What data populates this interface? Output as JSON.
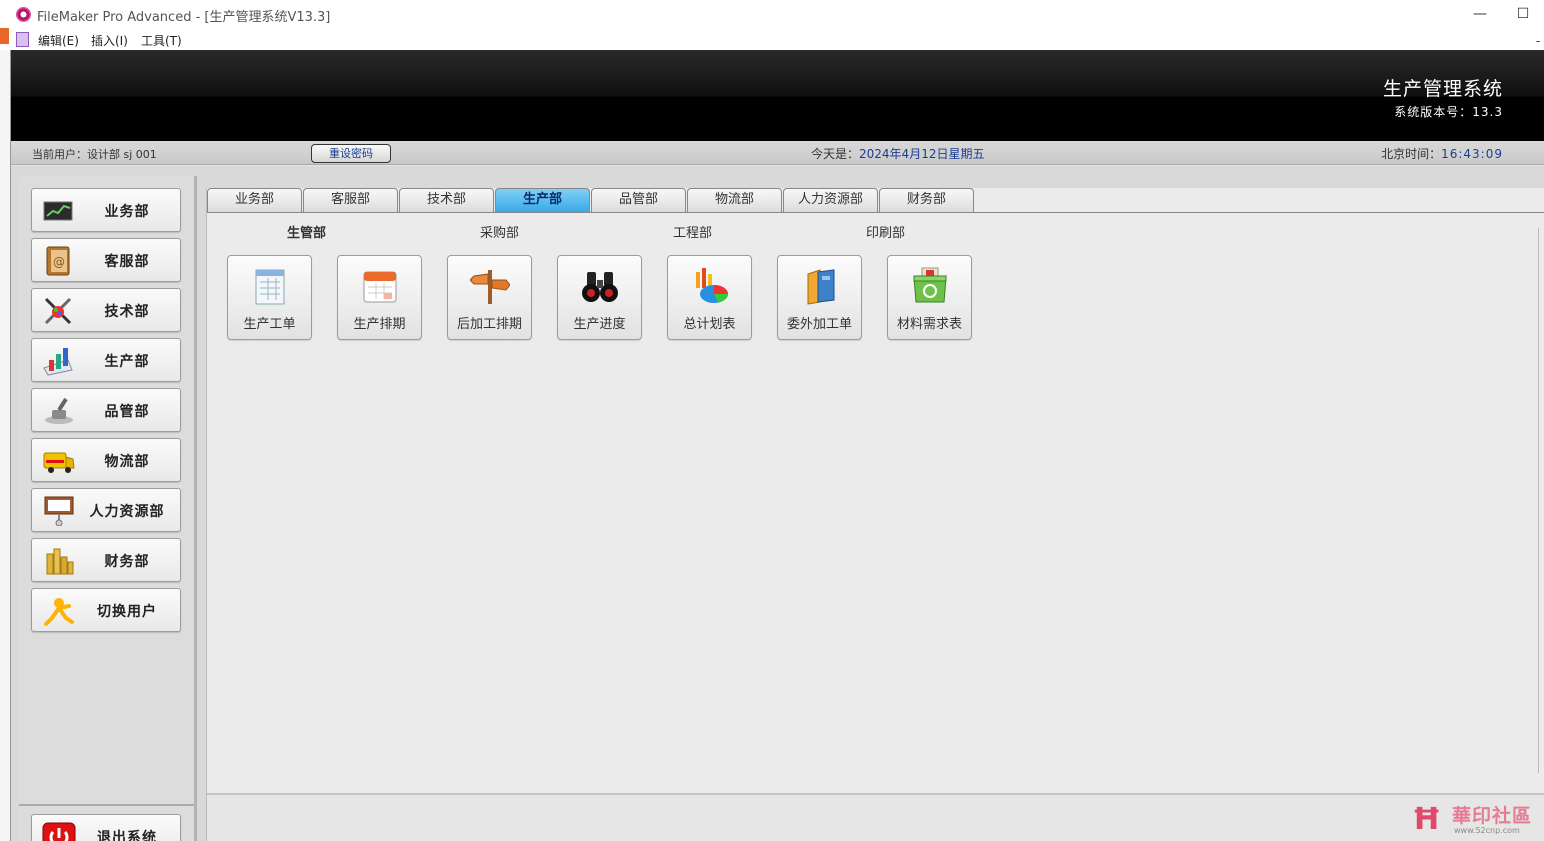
{
  "window": {
    "title": "FileMaker Pro Advanced - [生产管理系统V13.3]",
    "minimize": "—",
    "maximize": "☐"
  },
  "menu": {
    "items": [
      "编辑(E)",
      "插入(I)",
      "工具(T)"
    ],
    "corner_mark": "-"
  },
  "header": {
    "system_title": "生产管理系统",
    "version_label": "系统版本号：13.3"
  },
  "status": {
    "current_user": "当前用户：设计部 sj 001",
    "reset_password": "重设密码",
    "today_label": "今天是：",
    "today_value": "2024年4月12日星期五",
    "time_label": "北京时间：",
    "time_value": "16:43:09"
  },
  "sidebar": {
    "items": [
      {
        "label": "业务部",
        "icon": "chart-board-icon"
      },
      {
        "label": "客服部",
        "icon": "address-book-icon"
      },
      {
        "label": "技术部",
        "icon": "tools-palette-icon"
      },
      {
        "label": "生产部",
        "icon": "bar-chart-icon"
      },
      {
        "label": "品管部",
        "icon": "stamp-icon"
      },
      {
        "label": "物流部",
        "icon": "delivery-truck-icon"
      },
      {
        "label": "人力资源部",
        "icon": "presentation-board-icon"
      },
      {
        "label": "财务部",
        "icon": "coins-icon"
      },
      {
        "label": "切换用户",
        "icon": "user-switch-icon"
      }
    ],
    "exit": {
      "label": "退出系统",
      "icon": "power-icon"
    }
  },
  "tabs": {
    "items": [
      "业务部",
      "客服部",
      "技术部",
      "生产部",
      "品管部",
      "物流部",
      "人力资源部",
      "财务部"
    ],
    "active": "生产部"
  },
  "sections": [
    "生管部",
    "采购部",
    "工程部",
    "印刷部"
  ],
  "functions": [
    {
      "label": "生产工单",
      "icon": "work-order-icon"
    },
    {
      "label": "生产排期",
      "icon": "calendar-icon"
    },
    {
      "label": "后加工排期",
      "icon": "signpost-icon"
    },
    {
      "label": "生产进度",
      "icon": "binoculars-icon"
    },
    {
      "label": "总计划表",
      "icon": "pie-chart-icon"
    },
    {
      "label": "委外加工单",
      "icon": "folder-icon"
    },
    {
      "label": "材料需求表",
      "icon": "recycle-bin-icon"
    }
  ],
  "watermark": {
    "text": "華印社區",
    "url": "www.52cnp.com"
  },
  "colors": {
    "active_tab": "#39a9e6",
    "link_blue": "#1b3d8f",
    "header_bg": "#000000"
  }
}
